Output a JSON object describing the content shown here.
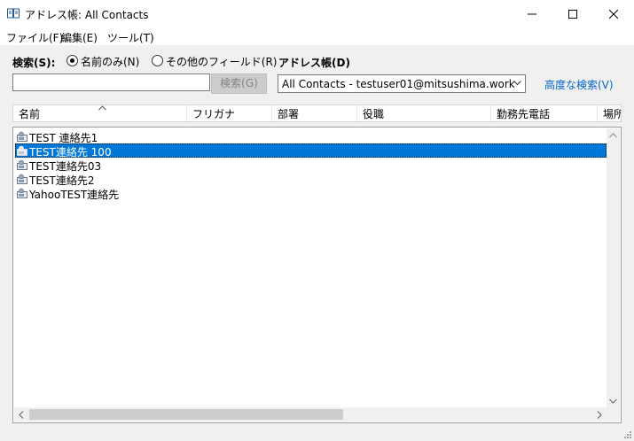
{
  "window": {
    "title": "アドレス帳: All Contacts"
  },
  "menu": [
    {
      "label": "ファイル(F)"
    },
    {
      "label": "編集(E)"
    },
    {
      "label": "ツール(T)"
    }
  ],
  "search": {
    "label": "検索(S):",
    "option_name_only": "名前のみ(N)",
    "option_other_fields": "その他のフィールド(R)",
    "selected_option": "name_only",
    "input_value": "",
    "button_label": "検索(G)"
  },
  "address_book": {
    "label": "アドレス帳(D)",
    "selected_value": "All Contacts - testuser01@mitsushima.work",
    "advanced_link": "高度な検索(V)"
  },
  "columns": [
    "名前",
    "フリガナ",
    "部署",
    "役職",
    "勤務先電話",
    "場所"
  ],
  "contacts": [
    {
      "name": "TEST 連絡先1",
      "selected": false
    },
    {
      "name": "TEST連絡先 100",
      "selected": true
    },
    {
      "name": "TEST連絡先03",
      "selected": false
    },
    {
      "name": "TEST連絡先2",
      "selected": false
    },
    {
      "name": "YahooTEST連絡先",
      "selected": false
    }
  ],
  "colors": {
    "accent": "#0078d7",
    "link": "#0066cc",
    "window_bg": "#f0f0f0"
  },
  "icons": {
    "title": "address-book-icon",
    "contact": "contact-card-icon",
    "sort": "sort-ascending-icon"
  }
}
